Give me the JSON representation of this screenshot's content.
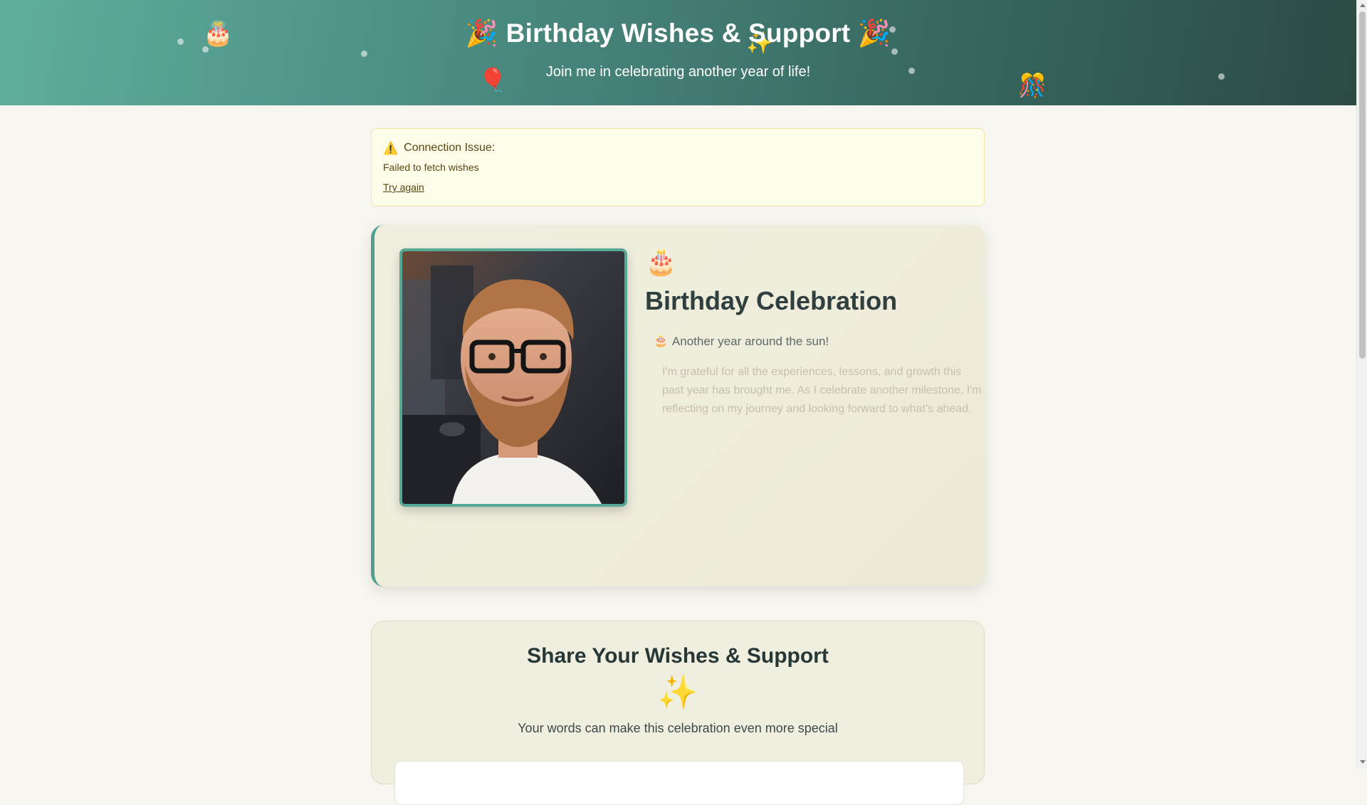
{
  "header": {
    "title": "🎉 Birthday Wishes & Support 🎉",
    "subtitle": "Join me in celebrating another year of life!",
    "decor_icons": [
      "cake-icon",
      "balloon-icon",
      "sparkle-icon",
      "confetti-icon"
    ]
  },
  "alert": {
    "icon": "⚠️",
    "title": "Connection Issue:",
    "message": "Failed to fetch wishes",
    "retry_label": "Try again"
  },
  "celebration": {
    "icon": "🎂",
    "title": "Birthday Celebration",
    "tagline_icon": "🎂",
    "tagline": "Another year around the sun!",
    "body": "I'm grateful for all the experiences, lessons, and growth this past year has brought me. As I celebrate another milestone, I'm reflecting on my journey and looking forward to what's ahead."
  },
  "wishes": {
    "title": "Share Your Wishes & Support",
    "icon": "✨",
    "subtitle": "Your words can make this celebration even more special"
  },
  "colors": {
    "accent": "#4f9e8f",
    "header_start": "#5fae9c",
    "header_end": "#2b4a44",
    "alert_bg": "#fdfbe9",
    "alert_text": "#5a4712"
  }
}
